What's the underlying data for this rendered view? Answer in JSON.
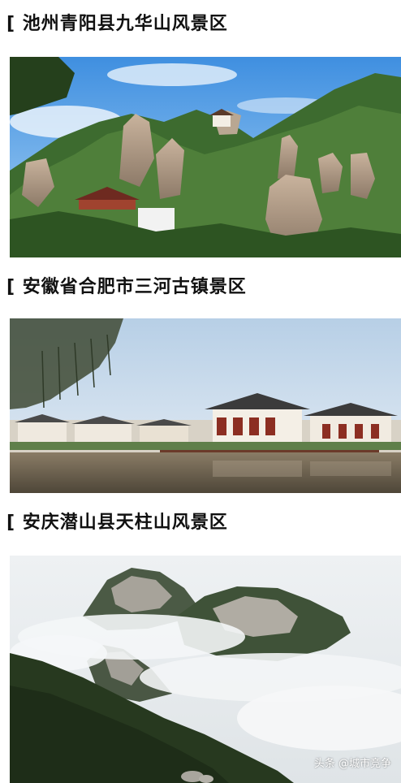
{
  "sections": [
    {
      "title": "[ 池州青阳县九华山风景区",
      "image_alt": "九华山风景区"
    },
    {
      "title": "[ 安徽省合肥市三河古镇景区",
      "image_alt": "三河古镇景区"
    },
    {
      "title": "[ 安庆潜山县天柱山风景区",
      "image_alt": "天柱山风景区"
    }
  ],
  "watermark": "头条 @城市竞争"
}
